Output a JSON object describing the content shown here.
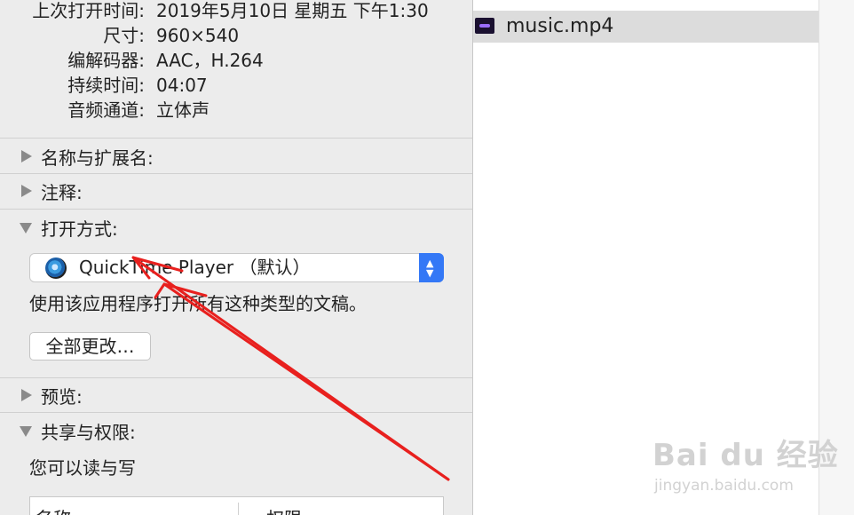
{
  "info_panel": {
    "metadata": [
      {
        "key": "上次打开时间:",
        "value": "2019年5月10日 星期五 下午1:30"
      },
      {
        "key": "尺寸:",
        "value": "960×540"
      },
      {
        "key": "编解码器:",
        "value": "AAC，H.264"
      },
      {
        "key": "持续时间:",
        "value": "04:07"
      },
      {
        "key": "音频通道:",
        "value": "立体声"
      }
    ],
    "sections": {
      "name_ext": "名称与扩展名:",
      "comments": "注释:",
      "open_with": "打开方式:",
      "preview": "预览:",
      "sharing": "共享与权限:"
    },
    "open_with": {
      "app_label": "QuickTime Player （默认）",
      "description": "使用该应用程序打开所有这种类型的文稿。",
      "change_all_label": "全部更改…"
    },
    "sharing": {
      "status": "您可以读与写",
      "columns": [
        "名称",
        "权限"
      ]
    }
  },
  "finder": {
    "file_name": "music.mp4"
  },
  "watermark": {
    "brand": "Bai du 经验",
    "site": "jingyan.baidu.com"
  },
  "colors": {
    "panel_bg": "#ececec",
    "accent": "#3478f6",
    "selection": "#dcdcdc",
    "annotation": "#e8201e"
  }
}
